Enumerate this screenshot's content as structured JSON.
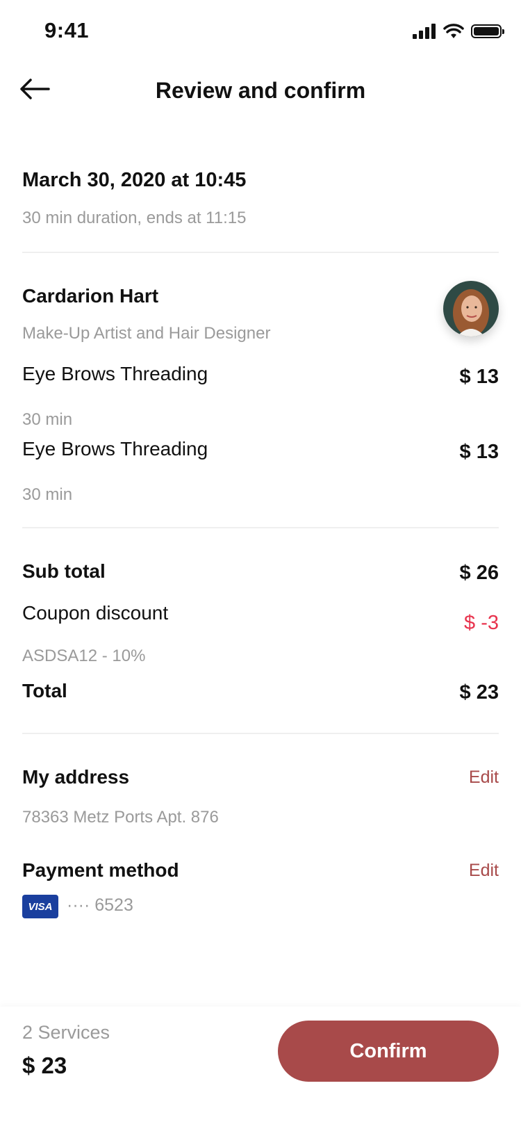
{
  "status_bar": {
    "time": "9:41"
  },
  "header": {
    "title": "Review and confirm"
  },
  "appointment": {
    "date": "March 30, 2020 at 10:45",
    "duration": "30 min duration, ends at 11:15"
  },
  "artist": {
    "name": "Cardarion Hart",
    "role": "Make-Up Artist and Hair Designer"
  },
  "services": [
    {
      "name": "Eye Brows Threading",
      "duration": "30 min",
      "price": "$ 13"
    },
    {
      "name": "Eye Brows Threading",
      "duration": "30 min",
      "price": "$ 13"
    }
  ],
  "summary": {
    "subtotal_label": "Sub total",
    "subtotal_value": "$ 26",
    "coupon_label": "Coupon discount",
    "coupon_value": "$ -3",
    "coupon_code": "ASDSA12 - 10%",
    "total_label": "Total",
    "total_value": "$ 23"
  },
  "address": {
    "label": "My address",
    "value": "78363 Metz Ports Apt. 876",
    "edit": "Edit"
  },
  "payment": {
    "label": "Payment method",
    "card_brand": "VISA",
    "card_number": "···· 6523",
    "edit": "Edit"
  },
  "footer": {
    "services_count": "2 Services",
    "total": "$ 23",
    "confirm_label": "Confirm"
  },
  "colors": {
    "accent": "#a84a4a",
    "discount": "#e8344e",
    "muted": "#9a9a9a"
  }
}
